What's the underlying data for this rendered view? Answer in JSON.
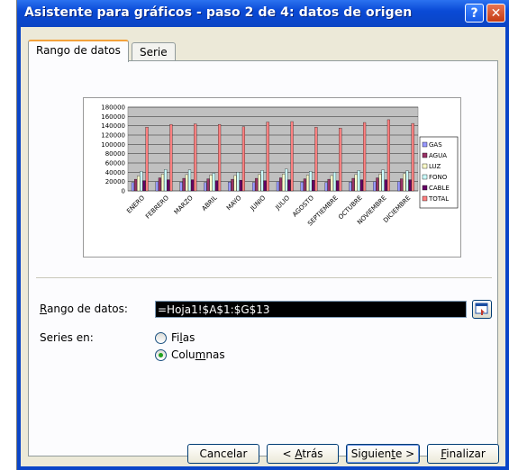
{
  "window": {
    "title": "Asistente para gráficos - paso 2 de 4: datos de origen",
    "help_symbol": "?",
    "close_symbol": "✕"
  },
  "tabs": [
    {
      "label": "Rango de datos",
      "active": true
    },
    {
      "label": "Serie",
      "active": false
    }
  ],
  "chart_data": {
    "type": "bar",
    "categories": [
      "ENERO",
      "FEBRERO",
      "MARZO",
      "ABRIL",
      "MAYO",
      "JUNIO",
      "JULIO",
      "AGOSTO",
      "SEPTIEMBRE",
      "OCTUBRE",
      "NOVIEMBRE",
      "DICIEMBRE"
    ],
    "ylim": [
      0,
      180000
    ],
    "yticks": [
      "180000",
      "160000",
      "140000",
      "120000",
      "100000",
      "80000",
      "60000",
      "40000",
      "20000",
      "0"
    ],
    "legend_position": "right",
    "grid": true,
    "series": [
      {
        "name": "GAS",
        "color": "#9999ff",
        "values": [
          18000,
          20000,
          19000,
          18000,
          19000,
          18000,
          20000,
          19000,
          18000,
          19000,
          20000,
          20000
        ]
      },
      {
        "name": "AGUA",
        "color": "#993366",
        "values": [
          25000,
          28000,
          27000,
          26000,
          25000,
          27000,
          28000,
          26000,
          25000,
          27000,
          28000,
          26000
        ]
      },
      {
        "name": "LUZ",
        "color": "#ffffcc",
        "values": [
          32000,
          36000,
          35000,
          34000,
          33000,
          35000,
          36000,
          34000,
          33000,
          35000,
          36000,
          37000
        ]
      },
      {
        "name": "FONO",
        "color": "#ccffff",
        "values": [
          42000,
          46000,
          45000,
          38000,
          40000,
          44000,
          47000,
          42000,
          40000,
          44000,
          45000,
          43000
        ]
      },
      {
        "name": "CABLE",
        "color": "#660066",
        "values": [
          22000,
          24000,
          24000,
          22000,
          23000,
          22000,
          24000,
          23000,
          22000,
          24000,
          24000,
          24000
        ]
      },
      {
        "name": "TOTAL",
        "color": "#ff8080",
        "values": [
          137000,
          143000,
          144000,
          143000,
          138000,
          148000,
          149000,
          137000,
          135000,
          147000,
          153000,
          145000
        ]
      }
    ]
  },
  "form": {
    "range_label_u": "R",
    "range_label_rest": "ango de datos:",
    "range_value": "=Hoja1!$A$1:$G$13",
    "series_label": "Series en:",
    "filas_pre": "Fi",
    "filas_u": "l",
    "filas_post": "as",
    "columnas_pre": "Colu",
    "columnas_u": "m",
    "columnas_post": "nas",
    "selected": "Columnas"
  },
  "buttons": {
    "cancel": "Cancelar",
    "back_pre": "< ",
    "back_u": "A",
    "back_post": "trás",
    "next_pre": "Siguien",
    "next_u": "t",
    "next_post": "e >",
    "finish_u": "F",
    "finish_post": "inalizar"
  }
}
